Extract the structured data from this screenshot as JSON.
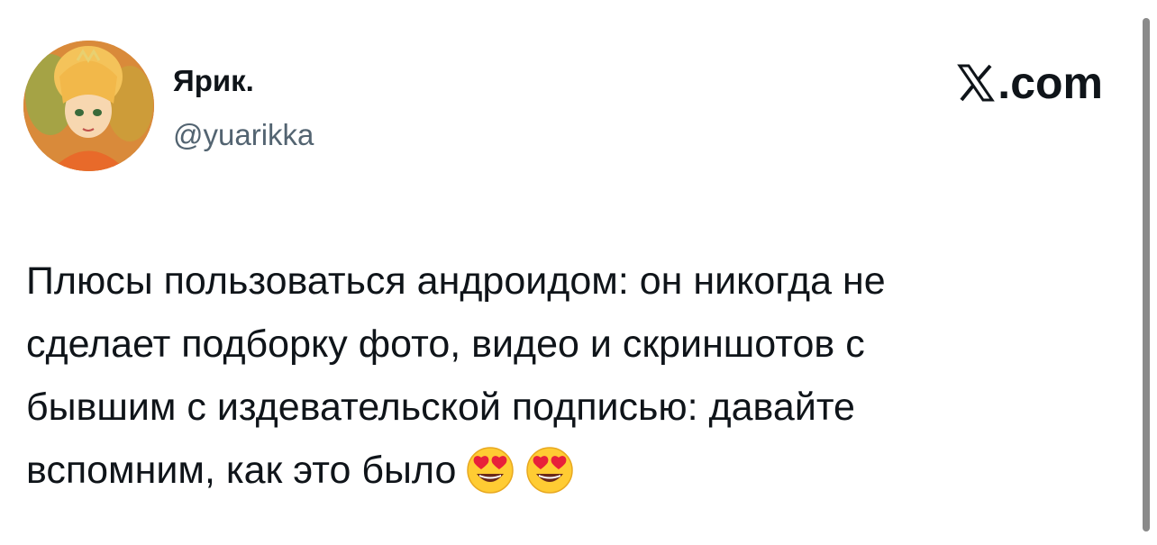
{
  "author": {
    "name": "Ярик.",
    "handle": "@yuarikka",
    "avatar_icon": "anime-avatar"
  },
  "brand": {
    "logo_icon": "x-logo-icon",
    "domain": ".com"
  },
  "tweet": {
    "lines": [
      "Плюсы пользоваться андроидом: он никогда не",
      "сделает подборку фото, видео и скриншотов с",
      "бывшим с издевательской подписью: давайте",
      "вспомним, как это было"
    ],
    "emojis": [
      "heart-eyes-emoji",
      "heart-eyes-emoji"
    ]
  },
  "colors": {
    "text": "#0f1419",
    "handle": "#536471",
    "background": "#ffffff"
  }
}
